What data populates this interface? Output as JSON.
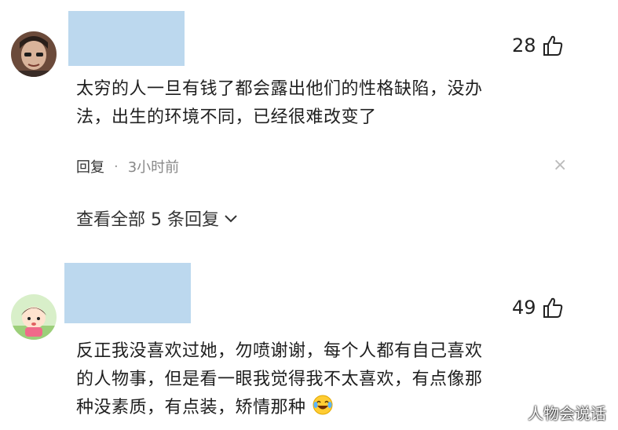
{
  "comments": [
    {
      "likes": "28",
      "text": "太穷的人一旦有钱了都会露出他们的性格缺陷，没办法，出生的环境不同，已经很难改变了",
      "line1": "太穷的人一旦有钱了都会露出他们的性格缺陷，没办",
      "line2": "法，出生的环境不同，已经很难改变了",
      "reply_label": "回复",
      "separator": "·",
      "time": "3小时前",
      "close_glyph": "×",
      "view_all": "查看全部 5 条回复"
    },
    {
      "likes": "49",
      "text": "反正我没喜欢过她，勿喷谢谢，每个人都有自己喜欢的人物事，但是看一眼我觉得我不太喜欢，有点像那种没素质，有点装，矫情那种",
      "line1": "反正我没喜欢过她，勿喷谢谢，每个人都有自己喜欢",
      "line2": "的人物事，但是看一眼我觉得我不太喜欢，有点像那",
      "line3": "种没素质，有点装，矫情那种",
      "emoji": "crying-laughing-emoji"
    }
  ],
  "watermark": "人物会说话",
  "colors": {
    "redaction": "#bcd8ee",
    "text": "#1f1f1f",
    "muted": "#888888"
  }
}
